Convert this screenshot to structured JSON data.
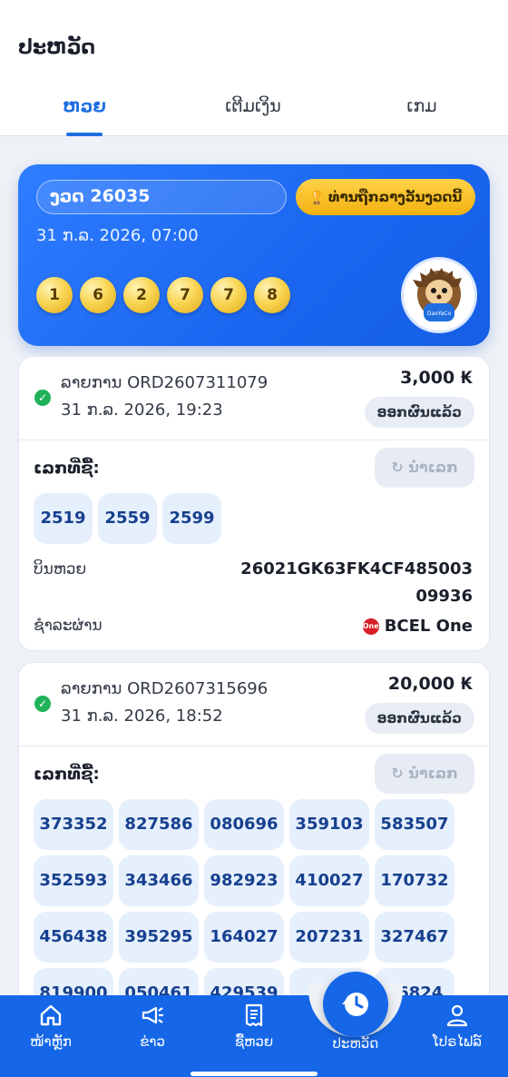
{
  "header": {
    "title": "ປະຫວັດ"
  },
  "tabs": [
    {
      "label": "ຫວຍ",
      "active": true
    },
    {
      "label": "ເຕີມເງິນ",
      "active": false
    },
    {
      "label": "ເກມ",
      "active": false
    }
  ],
  "hero": {
    "round_label": "ງວດ 26035",
    "winners_button": "ທ່ານຖືກລາງວັນງວດນີ້",
    "draw_date": "31 ກ.ລ. 2026, 07:00",
    "balls": [
      "1",
      "6",
      "2",
      "7",
      "7",
      "8"
    ],
    "mascot_text": "DaoYaCo"
  },
  "orders": [
    {
      "label": "ລາຍການ ORD2607311079",
      "date": "31 ກ.ລ. 2026, 19:23",
      "amount": "3,000 ₭",
      "status": "ອອກຜົນແລ້ວ",
      "numbers_label": "ເລກທີ່ຊື້:",
      "reuse_label": "ນຳເລກ",
      "numbers": [
        "2519",
        "2559",
        "2599"
      ],
      "bill_label": "ບິນຫວຍ",
      "bill_value_line1": "26021GK63FK4CF485003",
      "bill_value_line2": "09936",
      "payment_label": "ຊຳລະຜ່ານ",
      "payment_value": "BCEL One",
      "payment_badge": "One"
    },
    {
      "label": "ລາຍການ ORD2607315696",
      "date": "31 ກ.ລ. 2026, 18:52",
      "amount": "20,000 ₭",
      "status": "ອອກຜົນແລ້ວ",
      "numbers_label": "ເລກທີ່ຊື້:",
      "reuse_label": "ນຳເລກ",
      "numbers": [
        "373352",
        "827586",
        "080696",
        "359103",
        "583507",
        "352593",
        "343466",
        "982923",
        "410027",
        "170732",
        "456438",
        "395295",
        "164027",
        "207231",
        "327467",
        "819900",
        "050461",
        "429539",
        "53",
        "56824"
      ]
    }
  ],
  "bottom_nav": [
    {
      "label": "ໜ້າຫຼັກ",
      "icon": "home-icon"
    },
    {
      "label": "ຂ່າວ",
      "icon": "megaphone-icon"
    },
    {
      "label": "ຊື້ຫວຍ",
      "icon": "receipt-icon"
    },
    {
      "label": "ປະຫວັດ",
      "icon": "history-icon"
    },
    {
      "label": "ໂປຣໄຟລ໌",
      "icon": "profile-icon"
    }
  ],
  "colors": {
    "primary": "#1567e8",
    "accent_gold": "#f2b10f",
    "success": "#1fb25a"
  }
}
